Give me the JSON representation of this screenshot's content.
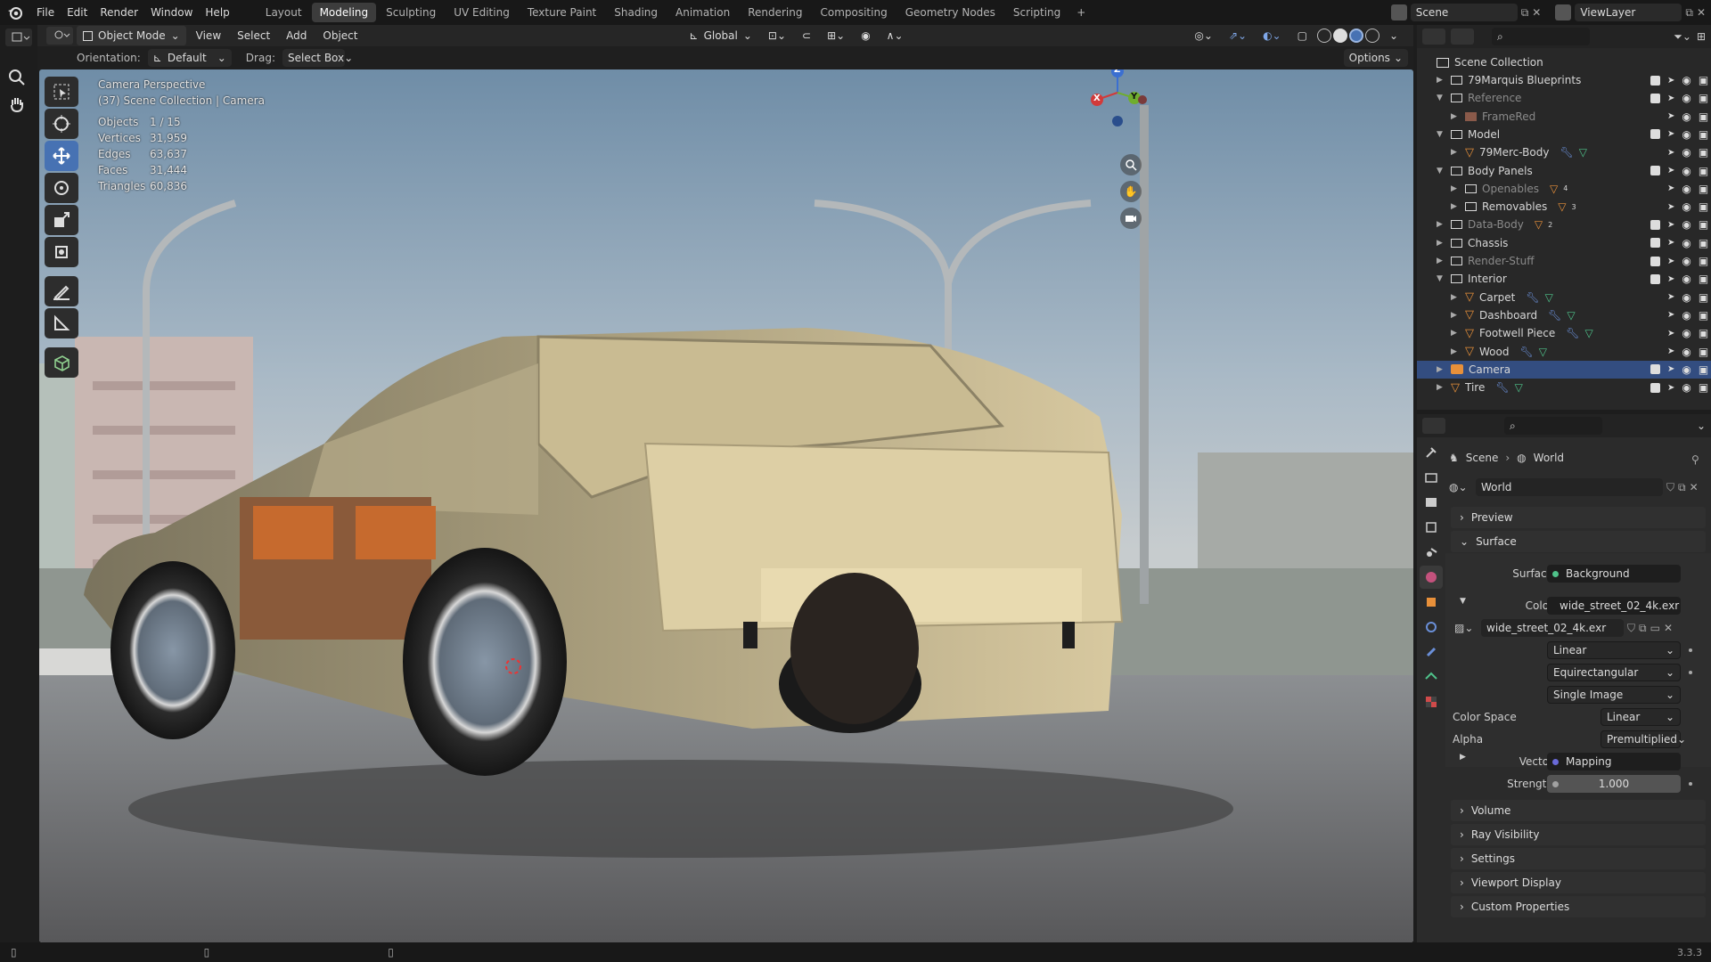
{
  "app": {
    "version": "3.3.3"
  },
  "menu": [
    "File",
    "Edit",
    "Render",
    "Window",
    "Help"
  ],
  "workspaces": [
    "Layout",
    "Modeling",
    "Sculpting",
    "UV Editing",
    "Texture Paint",
    "Shading",
    "Animation",
    "Rendering",
    "Compositing",
    "Geometry Nodes",
    "Scripting"
  ],
  "active_workspace": "Modeling",
  "scene_name": "Scene",
  "view_layer": "ViewLayer",
  "header": {
    "mode": "Object Mode",
    "view": "View",
    "select": "Select",
    "add": "Add",
    "object": "Object",
    "transform": "Global"
  },
  "tool_header": {
    "orientation_label": "Orientation:",
    "orientation": "Default",
    "drag_label": "Drag:",
    "drag": "Select Box",
    "options": "Options"
  },
  "viewport": {
    "title": "Camera Perspective",
    "subtitle": "(37) Scene Collection | Camera",
    "stats": [
      {
        "k": "Objects",
        "v": "1 / 15"
      },
      {
        "k": "Vertices",
        "v": "31,959"
      },
      {
        "k": "Edges",
        "v": "63,637"
      },
      {
        "k": "Faces",
        "v": "31,444"
      },
      {
        "k": "Triangles",
        "v": "60,836"
      }
    ],
    "gizmo": {
      "x": "X",
      "y": "Y",
      "z": "Z"
    }
  },
  "outliner": {
    "root": "Scene Collection",
    "rows": [
      {
        "name": "79Marquis Blueprints",
        "indent": 1,
        "type": "collection",
        "badge": ""
      },
      {
        "name": "Reference",
        "indent": 1,
        "type": "collection",
        "dim": true
      },
      {
        "name": "FrameRed",
        "indent": 2,
        "type": "image",
        "dim": true
      },
      {
        "name": "Model",
        "indent": 1,
        "type": "collection"
      },
      {
        "name": "79Merc-Body",
        "indent": 2,
        "type": "mesh"
      },
      {
        "name": "Body Panels",
        "indent": 1,
        "type": "collection"
      },
      {
        "name": "Openables",
        "indent": 2,
        "type": "collection",
        "dim": true,
        "badge": "4"
      },
      {
        "name": "Removables",
        "indent": 2,
        "type": "collection",
        "badge": "3"
      },
      {
        "name": "Data-Body",
        "indent": 1,
        "type": "collection",
        "dim": true,
        "badge": "2"
      },
      {
        "name": "Chassis",
        "indent": 1,
        "type": "collection"
      },
      {
        "name": "Render-Stuff",
        "indent": 1,
        "type": "collection",
        "dim": true
      },
      {
        "name": "Interior",
        "indent": 1,
        "type": "collection"
      },
      {
        "name": "Carpet",
        "indent": 2,
        "type": "mesh"
      },
      {
        "name": "Dashboard",
        "indent": 2,
        "type": "mesh"
      },
      {
        "name": "Footwell Piece",
        "indent": 2,
        "type": "mesh"
      },
      {
        "name": "Wood",
        "indent": 2,
        "type": "mesh"
      },
      {
        "name": "Camera",
        "indent": 1,
        "type": "camera",
        "selected": true
      },
      {
        "name": "Tire",
        "indent": 1,
        "type": "mesh"
      }
    ]
  },
  "properties": {
    "breadcrumb": {
      "scene": "Scene",
      "world": "World"
    },
    "world_name": "World",
    "panels": {
      "preview": "Preview",
      "surface": "Surface",
      "volume": "Volume",
      "ray": "Ray Visibility",
      "settings": "Settings",
      "viewport_display": "Viewport Display",
      "custom": "Custom Properties"
    },
    "surface": {
      "surface_label": "Surface",
      "surface_value": "Background",
      "color_label": "Color",
      "color_value": "wide_street_02_4k.exr",
      "image_name": "wide_street_02_4k.exr",
      "interp": "Linear",
      "projection": "Equirectangular",
      "source": "Single Image",
      "cs_label": "Color Space",
      "cs_value": "Linear",
      "alpha_label": "Alpha",
      "alpha_value": "Premultiplied",
      "vector_label": "Vector",
      "vector_value": "Mapping",
      "strength_label": "Strength",
      "strength_value": "1.000"
    }
  },
  "colors": {
    "accent": "#4772b3",
    "selected_row": "#334d80",
    "object_orange": "#e8903a",
    "collection": "#d9d9d9"
  }
}
